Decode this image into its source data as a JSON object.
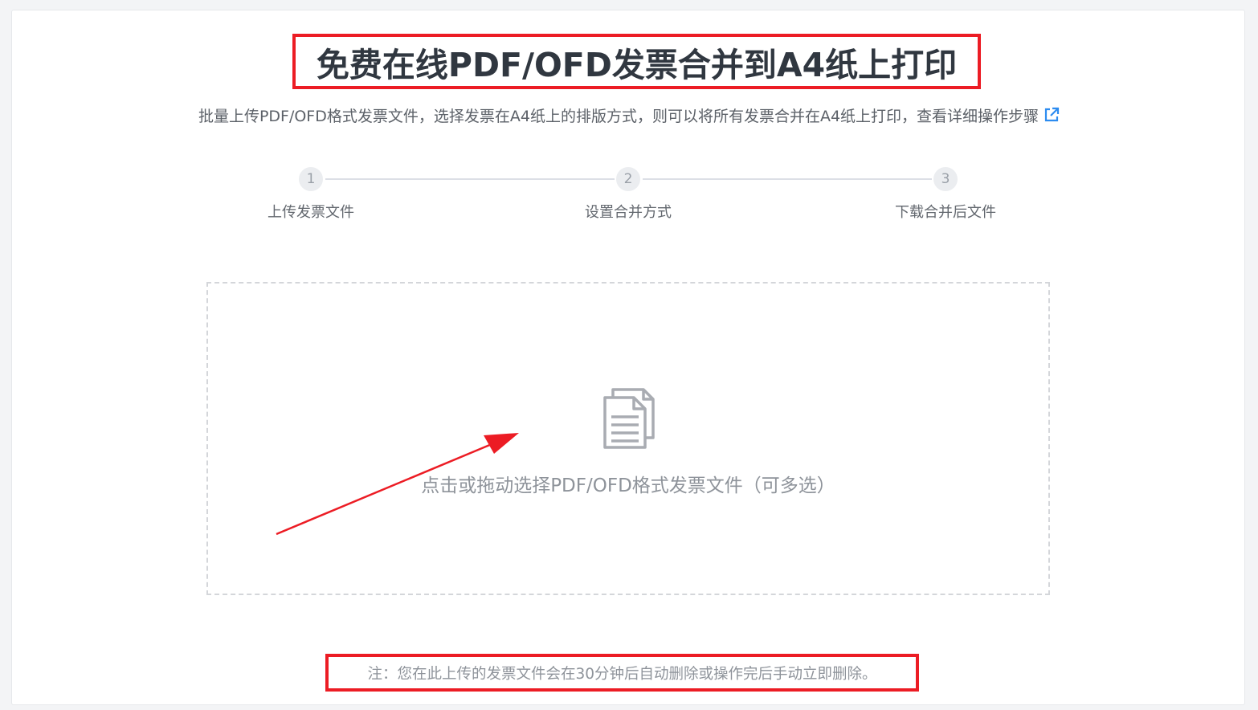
{
  "page": {
    "title": "免费在线PDF/OFD发票合并到A4纸上打印",
    "subtitle": "批量上传PDF/OFD格式发票文件，选择发票在A4纸上的排版方式，则可以将所有发票合并在A4纸上打印，查看详细操作步骤",
    "subtitle_link_icon": "external-link-icon"
  },
  "steps": [
    {
      "number": "1",
      "label": "上传发票文件"
    },
    {
      "number": "2",
      "label": "设置合并方式"
    },
    {
      "number": "3",
      "label": "下载合并后文件"
    }
  ],
  "upload": {
    "icon": "document-stack-icon",
    "prompt": "点击或拖动选择PDF/OFD格式发票文件（可多选）"
  },
  "note": "注：您在此上传的发票文件会在30分钟后自动删除或操作完后手动立即删除。",
  "colors": {
    "highlight_red": "#ec1c24",
    "title_text": "#303740",
    "link_blue": "#2d8cf0",
    "muted_text": "#8e939a"
  }
}
